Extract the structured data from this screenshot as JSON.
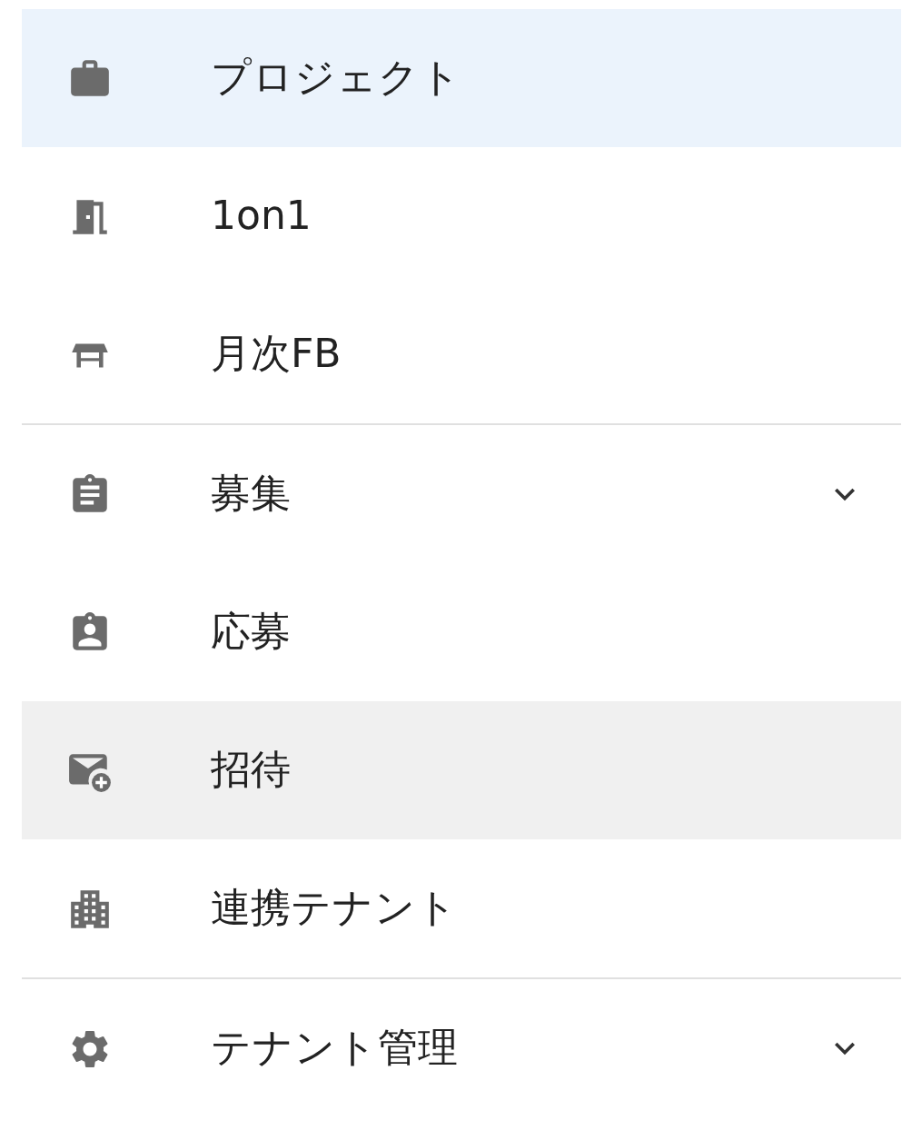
{
  "menu": {
    "groups": [
      {
        "items": [
          {
            "kind": "briefcase",
            "label": "プロジェクト",
            "selected": true,
            "hovered": false,
            "expandable": false
          },
          {
            "kind": "door",
            "label": "1on1",
            "selected": false,
            "hovered": false,
            "expandable": false
          },
          {
            "kind": "table",
            "label": "月次FB",
            "selected": false,
            "hovered": false,
            "expandable": false
          }
        ]
      },
      {
        "items": [
          {
            "kind": "clipboard",
            "label": "募集",
            "selected": false,
            "hovered": false,
            "expandable": true
          },
          {
            "kind": "badge",
            "label": "応募",
            "selected": false,
            "hovered": false,
            "expandable": false
          },
          {
            "kind": "mail",
            "label": "招待",
            "selected": false,
            "hovered": true,
            "expandable": false
          },
          {
            "kind": "building",
            "label": "連携テナント",
            "selected": false,
            "hovered": false,
            "expandable": false
          }
        ]
      },
      {
        "items": [
          {
            "kind": "settings",
            "label": "テナント管理",
            "selected": false,
            "hovered": false,
            "expandable": true
          }
        ]
      }
    ]
  }
}
